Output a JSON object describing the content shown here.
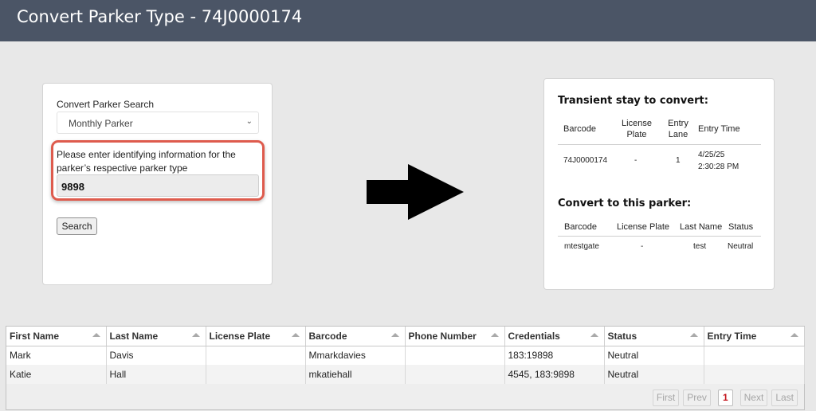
{
  "header": {
    "title": "Convert Parker Type - 74J0000174"
  },
  "search": {
    "label": "Convert Parker Search",
    "selected_type": "Monthly Parker",
    "prompt": "Please enter identifying information for the parker’s respective parker type",
    "input_value": "9898",
    "button_label": "Search"
  },
  "transient": {
    "title": "Transient stay to convert:",
    "columns": [
      "Barcode",
      "License Plate",
      "Entry Lane",
      "Entry Time"
    ],
    "row": {
      "barcode": "74J0000174",
      "license_plate": "-",
      "entry_lane": "1",
      "entry_time": "4/25/25 2:30:28 PM"
    }
  },
  "convert_to": {
    "title": "Convert to this parker:",
    "columns": [
      "Barcode",
      "License Plate",
      "Last Name",
      "Status"
    ],
    "row": {
      "barcode": "mtestgate",
      "license_plate": "-",
      "last_name": "test",
      "status": "Neutral"
    }
  },
  "grid": {
    "columns": [
      "First Name",
      "Last Name",
      "License Plate",
      "Barcode",
      "Phone Number",
      "Credentials",
      "Status",
      "Entry Time"
    ],
    "rows": [
      [
        "Mark",
        "Davis",
        "",
        "Mmarkdavies",
        "",
        "183:19898",
        "Neutral",
        ""
      ],
      [
        "Katie",
        "Hall",
        "",
        "mkatiehall",
        "",
        "4545, 183:9898",
        "Neutral",
        ""
      ]
    ],
    "pager": {
      "first": "First",
      "prev": "Prev",
      "current": "1",
      "next": "Next",
      "last": "Last"
    }
  },
  "colors": {
    "header_bg": "#4b5566",
    "highlight": "#de5b4d",
    "page_bg": "#e8e8e8",
    "current_page": "#c4151c"
  }
}
